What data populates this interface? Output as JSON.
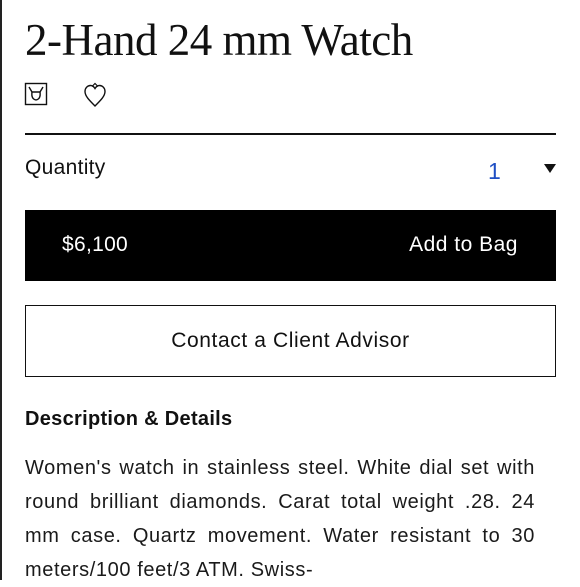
{
  "product": {
    "title": "2-Hand 24 mm Watch"
  },
  "icons": {
    "shopping_bag": "shopping-bag-icon",
    "wishlist_heart": "heart-icon"
  },
  "quantity": {
    "label": "Quantity",
    "selected": "1"
  },
  "purchase": {
    "price": "$6,100",
    "add_label": "Add to Bag"
  },
  "contact": {
    "label": "Contact a Client Advisor"
  },
  "description": {
    "heading": "Description & Details",
    "text": "Women's watch in stainless steel. White dial set with round brilliant diamonds. Carat total weight .28. 24 mm case. Quartz movement. Water resistant to 30 meters/100 feet/3 ATM. Swiss-"
  },
  "colors": {
    "button_bg": "#000000",
    "quantity_value": "#1f4fc4",
    "text": "#111111"
  }
}
